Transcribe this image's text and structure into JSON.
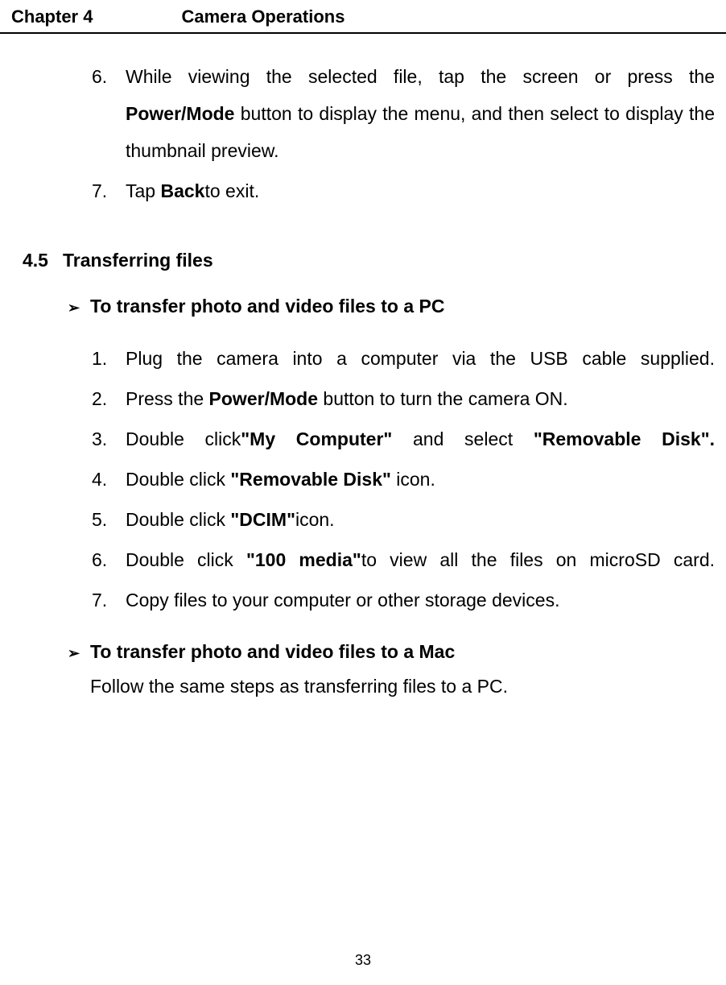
{
  "header": {
    "chapter": "Chapter 4",
    "title": "Camera Operations"
  },
  "top_list": {
    "item6": {
      "num": "6.",
      "pre1": "While viewing the selected file, tap the screen or press the ",
      "bold1": "Power/Mode",
      "post1": " button to display the menu, and then select to display the thumbnail preview."
    },
    "item7": {
      "num": "7.",
      "pre1": "Tap ",
      "bold1": "Back",
      "post1": "to exit."
    }
  },
  "section": {
    "num": "4.5",
    "title": "Transferring files"
  },
  "sub1": {
    "arrow": "➢",
    "title": "To transfer photo and video files to a PC",
    "items": {
      "i1": {
        "num": "1.",
        "text": "Plug the camera into a computer via the USB cable supplied."
      },
      "i2": {
        "num": "2.",
        "pre": "Press the ",
        "bold": "Power/Mode",
        "post": " button to turn the camera ON."
      },
      "i3": {
        "num": "3.",
        "pre": "Double click",
        "bold1": "\"My Computer\"",
        "mid": " and select ",
        "bold2": "\"Removable Disk\"."
      },
      "i4": {
        "num": "4.",
        "pre": "Double click ",
        "bold": "\"Removable Disk\"",
        "post": " icon."
      },
      "i5": {
        "num": "5.",
        "pre": "Double click ",
        "bold": "\"DCIM\"",
        "post": "icon."
      },
      "i6": {
        "num": "6.",
        "pre": "Double click ",
        "bold": "\"100 media\"",
        "post": "to view all the files on microSD card."
      },
      "i7": {
        "num": "7.",
        "text": "Copy files to your computer or other storage devices."
      }
    }
  },
  "sub2": {
    "arrow": "➢",
    "title": "To transfer photo and video files to a Mac",
    "body": "Follow the same steps as transferring files to a PC."
  },
  "page_number": "33"
}
